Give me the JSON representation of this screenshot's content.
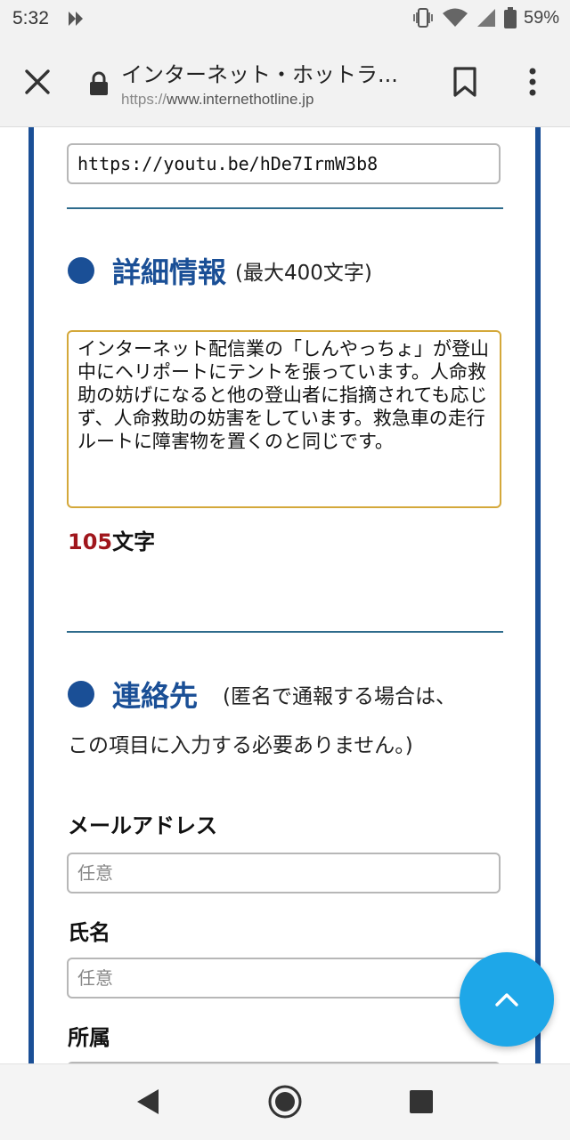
{
  "status_bar": {
    "time": "5:32",
    "battery_percent": "59%"
  },
  "browser": {
    "page_title": "インターネット・ホットラ...",
    "url_scheme": "https://",
    "url_host": "www.internethotline.jp"
  },
  "form": {
    "url_field": {
      "value": "https://youtu.be/hDe7IrmW3b8"
    },
    "details": {
      "title": "詳細情報",
      "note": "(最大400文字)",
      "text": "インターネット配信業の「しんやっちょ」が登山中にヘリポートにテントを張っています。人命救助の妨げになると他の登山者に指摘されても応じず、人命救助の妨害をしています。救急車の走行ルートに障害物を置くのと同じです。",
      "char_count": "105",
      "char_unit": "文字"
    },
    "contact": {
      "title": "連絡先",
      "note_line1": "(匿名で通報する場合は、",
      "note_line2": "この項目に入力する必要ありません。)",
      "email_label": "メールアドレス",
      "email_placeholder": "任意",
      "name_label": "氏名",
      "name_placeholder": "任意",
      "affiliation_label": "所属"
    }
  },
  "icons": {
    "close": "close-icon",
    "lock": "lock-icon",
    "bookmark": "bookmark-icon",
    "menu": "more-vert-icon",
    "scroll_top": "chevron-up-icon"
  },
  "colors": {
    "accent_blue": "#1a4f96",
    "fab_blue": "#1ea7e8",
    "count_red": "#a0161c",
    "textarea_focus": "#d4a83a"
  }
}
